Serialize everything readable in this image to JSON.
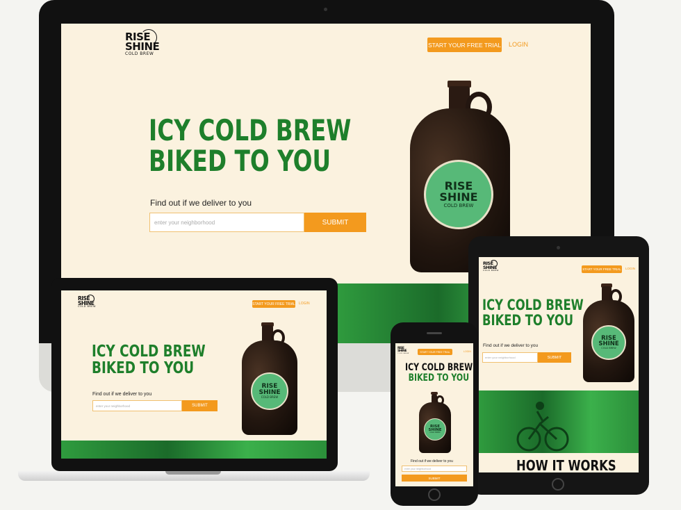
{
  "brand": {
    "logo_line1": "RISE",
    "logo_line2": "SHINE",
    "logo_amp": "&",
    "logo_line3": "COLD BREW"
  },
  "nav": {
    "trial_label": "START YOUR FREE TRIAL",
    "login_label": "LOGIN"
  },
  "hero": {
    "headline_line1": "ICY COLD BREW",
    "headline_line2": "BIKED TO YOU",
    "prompt": "Find out if we deliver to you",
    "input_placeholder": "enter your neighborhood",
    "submit_label": "SUBMIT"
  },
  "section": {
    "how_it_works": "HOW IT WORKS"
  },
  "colors": {
    "brand_green": "#1e7f2b",
    "accent_orange": "#f39a1e",
    "background_cream": "#fbf2df"
  }
}
